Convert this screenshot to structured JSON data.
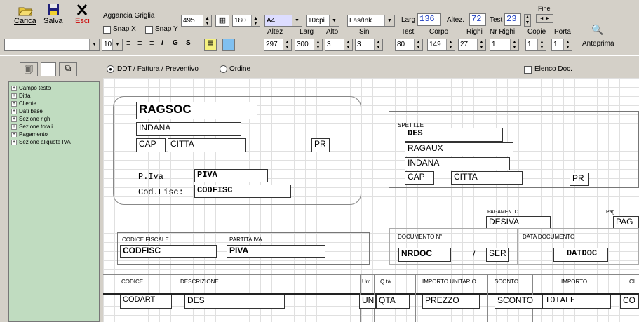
{
  "toolbar": {
    "carica": "Carica",
    "salva": "Salva",
    "esci": "Esci",
    "aggancia": "Aggancia Griglia",
    "snapx": "Snap X",
    "snapy": "Snap Y",
    "grid_x": "495",
    "grid_y": "180",
    "paper": "A4",
    "cpi": "10cpi",
    "printer": "Las/Ink",
    "larg_lbl": "Larg",
    "larg_val": "136",
    "altez_lbl": "Altez.",
    "altez_val": "72",
    "test_lbl": "Test",
    "test_val": "23",
    "fine_lbl": "Fine",
    "font_size": "10",
    "h_altez": "Altez",
    "h_larg": "Larg",
    "h_alto": "Alto",
    "h_sin": "Sin",
    "h_test": "Test",
    "h_corpo": "Corpo",
    "h_righi": "Righi",
    "h_nrrighi": "Nr Righi",
    "h_copie": "Copie",
    "h_porta": "Porta",
    "v_altez": "297",
    "v_larg": "300",
    "v_alto": "3",
    "v_sin": "3",
    "v_test": "80",
    "v_corpo": "149",
    "v_righi": "27",
    "v_nrrighi": "1",
    "v_copie": "1",
    "v_porta": "1",
    "anteprima": "Anteprima",
    "italic": "I",
    "grass": "G",
    "under": "S"
  },
  "panel": {
    "radio1": "DDT / Fattura / Preventivo",
    "radio2": "Ordine",
    "elenco": "Elenco Doc."
  },
  "tree": [
    "Campo testo",
    "Ditta",
    "Cliente",
    "Dati base",
    "Sezione righi",
    "Sezione totali",
    "Pagamento",
    "Sezione aliquote IVA"
  ],
  "fields": {
    "ragsoc": "RAGSOC",
    "indana": "INDANA",
    "cap": "CAP",
    "citta": "CITTA",
    "pr": "PR",
    "piva_lbl": "P.Iva",
    "piva": "PIVA",
    "codfisc_lbl": "Cod.Fisc:",
    "codfisc": "CODFISC",
    "spett": "SPETT.LE",
    "des": "DES",
    "ragaux": "RAGAUX",
    "indana2": "INDANA",
    "cap2": "CAP",
    "citta2": "CITTA",
    "pr2": "PR",
    "pag_lbl": "PAGAMENTO",
    "desiva": "DESIVA",
    "pag_short": "Pag.",
    "pag": "PAG",
    "cf_lbl": "CODICE FISCALE",
    "codfisc2": "CODFISC",
    "pi_lbl": "PARTITA IVA",
    "piva2": "PIVA",
    "doc_lbl": "DOCUMENTO N°",
    "nrdoc": "NRDOC",
    "slash": "/",
    "ser": "SER",
    "data_lbl": "DATA DOCUMENTO",
    "datdoc": "DATDOC",
    "col_codice": "CODICE",
    "col_desc": "DESCRIZIONE",
    "col_um": "Um",
    "col_qta": "Q.tà",
    "col_imp": "IMPORTO UNITARIO",
    "col_sconto": "SCONTO",
    "col_importo": "IMPORTO",
    "col_ci": "CI",
    "codart": "CODART",
    "des2": "DES",
    "un": "UN",
    "qta": "QTA",
    "prezzo": "PREZZO",
    "sconto": "SCONTO",
    "totale": "TOTALE",
    "co": "CO"
  }
}
